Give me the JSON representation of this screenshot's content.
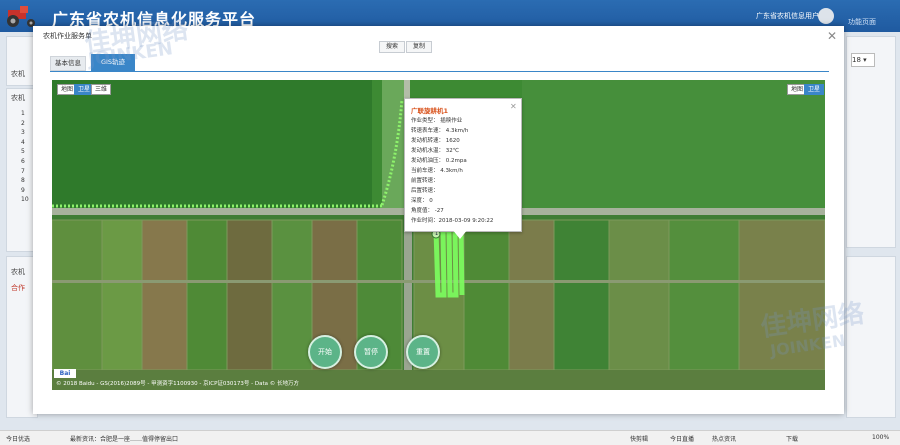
{
  "header": {
    "title": "广东省农机信息化服务平台",
    "user": "广东省农机信息用户",
    "function_page": "功能页面"
  },
  "background": {
    "left_label_1": "农机",
    "left_label_2": "农机",
    "left_label_3": "农机",
    "left_item": "合作",
    "list_numbers": [
      "1",
      "2",
      "3",
      "4",
      "5",
      "6",
      "7",
      "8",
      "9",
      "10"
    ],
    "right_value": "18"
  },
  "modal": {
    "title": "农机作业服务单",
    "toolbar": [
      "搜索",
      "复制"
    ],
    "tabs": [
      {
        "label": "基本信息",
        "active": false
      },
      {
        "label": "GIS轨迹",
        "active": true
      }
    ]
  },
  "map": {
    "type_buttons_left": [
      {
        "label": "地图",
        "active": false
      },
      {
        "label": "卫星",
        "active": true
      },
      {
        "label": "三维",
        "active": false
      }
    ],
    "type_buttons_right": [
      {
        "label": "地图",
        "active": false
      },
      {
        "label": "卫星",
        "active": true
      }
    ],
    "popup": {
      "title": "广联旋耕机1",
      "rows": [
        "作业类型： 插秧作业",
        "转速表车速： 4.3km/h",
        "发动机转速： 1620",
        "发动机水温： 32℃",
        "发动机油压： 0.2mpa",
        "当前车速： 4.3km/h",
        "前置转速：",
        "后置转速：",
        "深度： 0",
        "角度值： -27",
        "作业时间：2018-03-09 9:20:22"
      ]
    },
    "marker_label": "1",
    "controls": [
      "开始",
      "暂停",
      "重置"
    ],
    "baidu_logo": "Bai",
    "copyright": "© 2018 Baidu - GS(2016)2089号 - 甲测资字1100930 - 京ICP证030173号 - Data © 长地万方"
  },
  "statusbar": {
    "left": "今日优选",
    "news": "最新资讯：合肥是一座……值得停留出口",
    "items": [
      "快剪辑",
      "今日直播",
      "热点资讯",
      "下载",
      "100%"
    ]
  },
  "watermark": {
    "cn": "佳坤网络",
    "en": "JOINKEN"
  },
  "colors": {
    "accent": "#3a86c8",
    "header": "#1f5aa0",
    "control": "#5cb488"
  }
}
